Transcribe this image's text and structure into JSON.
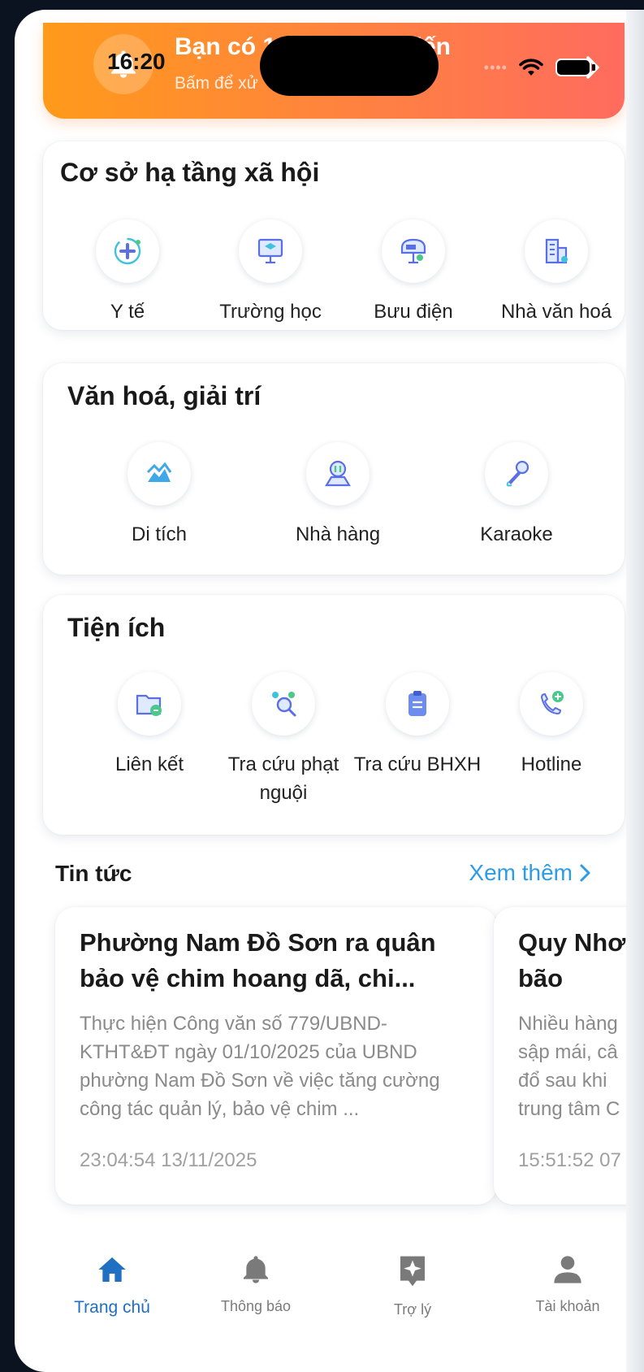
{
  "banner": {
    "title": "Bạn có 1 thông báo đến",
    "subtitle": "Bấm để xử",
    "accent_start": "#ff9a1a",
    "accent_end": "#ff6b5e"
  },
  "status_bar": {
    "time": "16:20",
    "icons": [
      "signal-dots-icon",
      "wifi-icon",
      "battery-icon"
    ]
  },
  "infrastructure": {
    "title": "Cơ sở hạ tầng xã hội",
    "items": [
      {
        "label": "Y tế",
        "icon": "medical-icon"
      },
      {
        "label": "Trường học",
        "icon": "school-icon"
      },
      {
        "label": "Bưu điện",
        "icon": "post-office-icon"
      },
      {
        "label": "Nhà văn hoá",
        "icon": "culture-house-icon"
      }
    ]
  },
  "culture": {
    "title": "Văn hoá, giải trí",
    "items": [
      {
        "label": "Di tích",
        "icon": "heritage-icon"
      },
      {
        "label": "Nhà hàng",
        "icon": "restaurant-icon"
      },
      {
        "label": "Karaoke",
        "icon": "microphone-icon"
      }
    ]
  },
  "utilities": {
    "title": "Tiện ích",
    "items": [
      {
        "label": "Liên kết",
        "icon": "folder-link-icon"
      },
      {
        "label": "Tra cứu phạt nguội",
        "icon": "traffic-fine-search-icon"
      },
      {
        "label": "Tra cứu BHXH",
        "icon": "clipboard-icon"
      },
      {
        "label": "Hotline",
        "icon": "phone-icon"
      }
    ]
  },
  "news": {
    "header": "Tin tức",
    "see_more": "Xem thêm",
    "items": [
      {
        "title": "Phường Nam Đồ Sơn ra quân bảo vệ chim hoang dã, chi...",
        "body": "Thực hiện Công văn số 779/UBND-KTHT&ĐT ngày 01/10/2025 của UBND phường Nam Đồ Sơn về việc tăng cường công tác quản lý, bảo vệ chim ...",
        "time": "23:04:54 13/11/2025"
      },
      {
        "title": "Quy Nhơ bão",
        "body": "Nhiều hàng sập mái, câ đổ sau khi trung tâm C",
        "time": "15:51:52 07"
      }
    ]
  },
  "bottom_nav": {
    "active_color": "#1f6fc2",
    "items": [
      {
        "label": "Trang chủ",
        "icon": "home-icon"
      },
      {
        "label": "Thông báo",
        "icon": "bell-icon"
      },
      {
        "label": "Trợ lý",
        "icon": "assistant-icon"
      },
      {
        "label": "Tài khoản",
        "icon": "account-icon"
      }
    ]
  }
}
